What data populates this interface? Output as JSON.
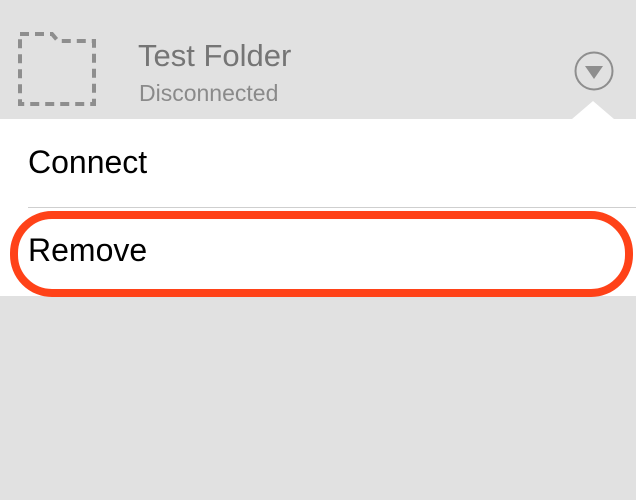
{
  "folder": {
    "title": "Test Folder",
    "status": "Disconnected",
    "icon": "dashed-folder-icon"
  },
  "expand_button": {
    "icon": "chevron-down-circle-icon"
  },
  "menu": {
    "items": [
      {
        "label": "Connect"
      },
      {
        "label": "Remove"
      }
    ]
  },
  "colors": {
    "background": "#e1e1e1",
    "menu_background": "#ffffff",
    "highlight": "#ff4218",
    "icon_gray": "#8e8e8e"
  }
}
